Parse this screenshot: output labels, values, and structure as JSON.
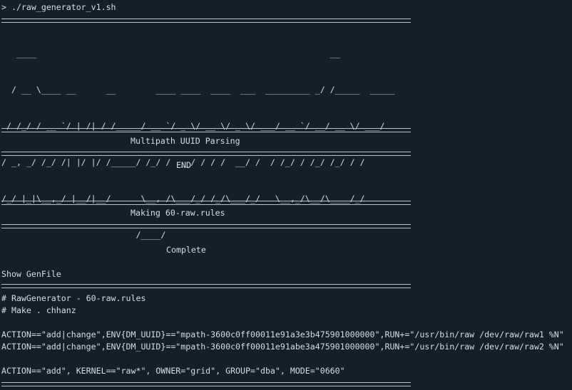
{
  "terminal": {
    "top_partial": "",
    "command_line": "> ./raw_generator_v1.sh",
    "banner_lines": [
      "   ____                                                           __",
      "  / __ \\____ __      __        ____ ____  ____  ___  _________ _/ /_____  _____",
      " / /_/ / __ `/ | /| / /_____/ __ `/ _ \\/ __ \\/ _ \\/ ___/ __ `/ __/ __ \\/ ___/",
      "/ _, _/ /_/ /| |/ |/ /_____/ /_/ /  __/ / / /  __/ /  / /_/ / /_/ /_/ / /",
      "/_/ |_|\\__,_/ |__/|__/      \\__, /\\___/_/ /_/\\___/_/   \\__,_/\\__/\\____/_/",
      "                           /____/"
    ],
    "section1_title": "Multipath UUID Parsing",
    "section1_status": "END",
    "section2_title": "Making 60-raw.rules",
    "section2_status": "Complete",
    "show_genfile": "Show GenFile",
    "rules_file": {
      "comment1": "# RawGenerator - 60-raw.rules",
      "comment2": "# Make . chhanz",
      "rule1": "ACTION==\"add|change\",ENV{DM_UUID}==\"mpath-3600c0ff00011e91a3e3b475901000000\",RUN+=\"/usr/bin/raw /dev/raw/raw1 %N\"",
      "rule2": "ACTION==\"add|change\",ENV{DM_UUID}==\"mpath-3600c0ff00011e91abe3a475901000000\",RUN+=\"/usr/bin/raw /dev/raw/raw2 %N\"",
      "rule3": "ACTION==\"add\", KERNEL==\"raw*\", OWNER=\"grid\", GROUP=\"dba\", MODE=\"0660\""
    }
  },
  "colors": {
    "background": "#122029",
    "text": "#d6dde0",
    "rule": "#b8c3c7"
  }
}
